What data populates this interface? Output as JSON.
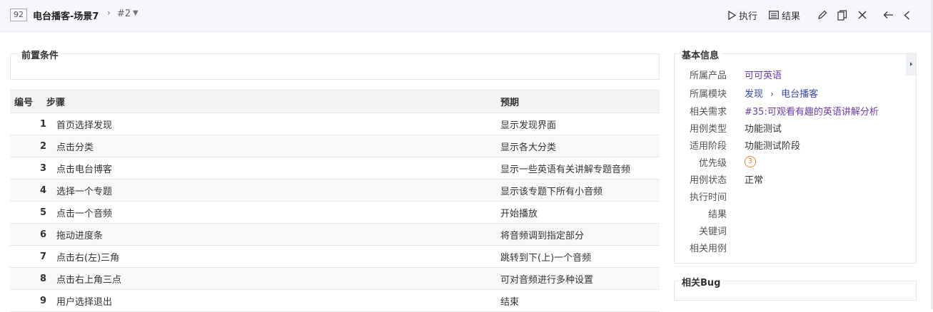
{
  "header": {
    "id": "92",
    "title": "电台播客-场景7",
    "version": "#2",
    "actions": {
      "run": "执行",
      "results": "结果"
    }
  },
  "precondition": {
    "legend": "前置条件"
  },
  "steps": {
    "columns": {
      "num": "编号",
      "step": "步骤",
      "expected": "预期"
    },
    "rows": [
      {
        "num": "1",
        "step": "首页选择发现",
        "expected": "显示发现界面"
      },
      {
        "num": "2",
        "step": "点击分类",
        "expected": "显示各大分类"
      },
      {
        "num": "3",
        "step": "点击电台博客",
        "expected": "显示一些英语有关讲解专题音频"
      },
      {
        "num": "4",
        "step": "选择一个专题",
        "expected": "显示该专题下所有小音频"
      },
      {
        "num": "5",
        "step": "点击一个音频",
        "expected": "开始播放"
      },
      {
        "num": "6",
        "step": "拖动进度条",
        "expected": "将音频调到指定部分"
      },
      {
        "num": "7",
        "step": "点击右(左)三角",
        "expected": "跳转到下(上)一个音频"
      },
      {
        "num": "8",
        "step": "点击右上角三点",
        "expected": "可对音频进行多种设置"
      },
      {
        "num": "9",
        "step": "用户选择退出",
        "expected": "结束"
      }
    ]
  },
  "basic_info": {
    "legend": "基本信息",
    "product_label": "所属产品",
    "product": "可可英语",
    "module_label": "所属模块",
    "module_parent": "发现",
    "module_child": "电台播客",
    "story_label": "相关需求",
    "story": "#35:可观看有趣的英语讲解分析",
    "type_label": "用例类型",
    "type": "功能测试",
    "stage_label": "适用阶段",
    "stage": "功能测试阶段",
    "priority_label": "优先级",
    "priority": "3",
    "status_label": "用例状态",
    "status": "正常",
    "exec_time_label": "执行时间",
    "result_label": "结果",
    "keywords_label": "关键词",
    "related_cases_label": "相关用例"
  },
  "related_bug": {
    "legend": "相关Bug"
  }
}
